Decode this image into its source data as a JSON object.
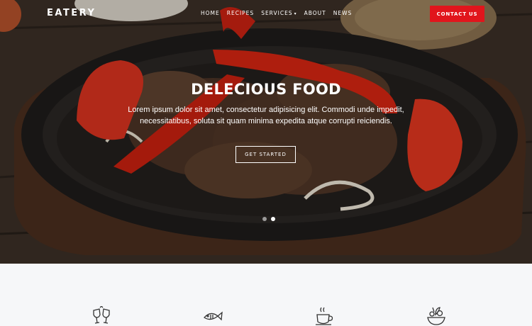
{
  "brand": "EATERY",
  "nav": {
    "items": [
      {
        "label": "HOME"
      },
      {
        "label": "RECIPES"
      },
      {
        "label": "SERVICES",
        "caret": "▾"
      },
      {
        "label": "ABOUT"
      },
      {
        "label": "NEWS"
      }
    ],
    "contact_label": "CONTACT US"
  },
  "hero": {
    "title": "DELECIOUS FOOD",
    "text": "Lorem ipsum dolor sit amet, consectetur adipisicing elit. Commodi unde impedit, necessitatibus, soluta sit quam minima expedita atque corrupti reiciendis.",
    "cta_label": "GET STARTED",
    "slides": 2,
    "active_slide": 2
  },
  "features": {
    "icons": [
      "wine-glasses-icon",
      "fish-icon",
      "coffee-cup-icon",
      "salad-bowl-icon"
    ]
  },
  "colors": {
    "accent": "#e1151c",
    "section_bg": "#f6f7f9",
    "icon_stroke": "#333333"
  }
}
